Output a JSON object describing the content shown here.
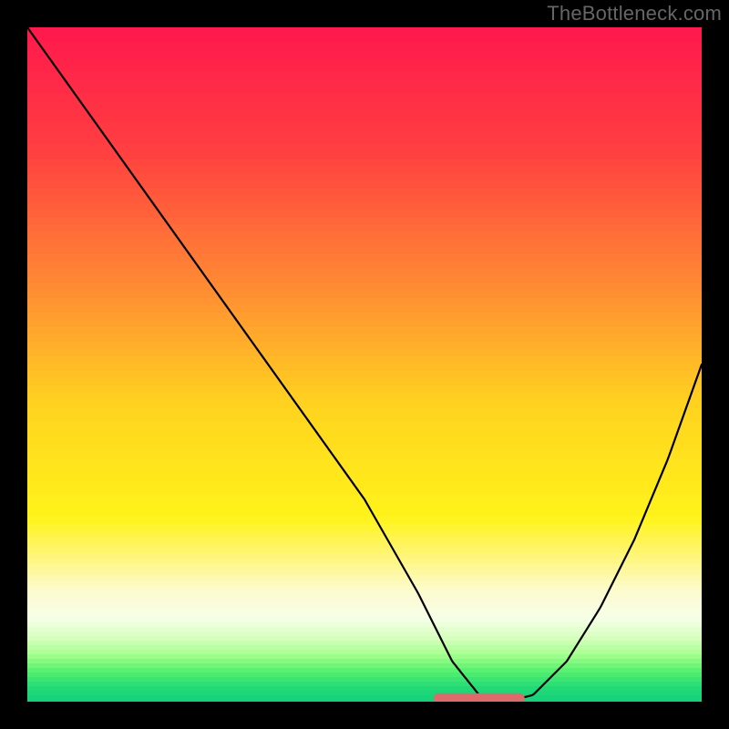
{
  "watermark": "TheBottleneck.com",
  "chart_data": {
    "type": "line",
    "title": "",
    "xlabel": "",
    "ylabel": "",
    "xlim": [
      0,
      100
    ],
    "ylim": [
      0,
      100
    ],
    "series": [
      {
        "name": "curve",
        "x": [
          0,
          10,
          20,
          30,
          40,
          50,
          58,
          63,
          67,
          71,
          75,
          80,
          85,
          90,
          95,
          100
        ],
        "values": [
          100,
          86,
          72,
          58,
          44,
          30,
          16,
          6,
          1,
          0,
          1,
          6,
          14,
          24,
          36,
          50
        ]
      }
    ],
    "highlight_segment": {
      "x_start": 61,
      "x_end": 73,
      "y": 0.5
    },
    "background_gradient": {
      "type": "vertical",
      "stops": [
        {
          "pos": 0.0,
          "color": "#ff1a4d"
        },
        {
          "pos": 0.18,
          "color": "#ff4040"
        },
        {
          "pos": 0.38,
          "color": "#ff8c33"
        },
        {
          "pos": 0.55,
          "color": "#ffd21f"
        },
        {
          "pos": 0.72,
          "color": "#fff31a"
        },
        {
          "pos": 0.78,
          "color": "#fff57d"
        },
        {
          "pos": 0.83,
          "color": "#fdfbcf"
        },
        {
          "pos": 0.87,
          "color": "#f6ffe8"
        },
        {
          "pos": 0.9,
          "color": "#d8ffc0"
        },
        {
          "pos": 0.925,
          "color": "#a8ff90"
        },
        {
          "pos": 0.95,
          "color": "#55f06e"
        },
        {
          "pos": 0.975,
          "color": "#22d977"
        },
        {
          "pos": 1.0,
          "color": "#0ecf7a"
        }
      ]
    }
  }
}
